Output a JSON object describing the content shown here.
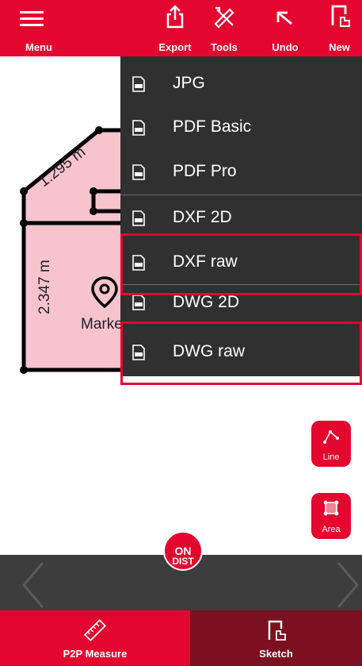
{
  "toolbar": {
    "menu_label": "Menu",
    "export_label": "Export",
    "tools_label": "Tools",
    "undo_label": "Undo",
    "new_label": "New"
  },
  "export_menu": {
    "items": [
      {
        "label": "JPG",
        "icon": "file-jpg-icon",
        "file_tag": "JPG"
      },
      {
        "label": "PDF Basic",
        "icon": "file-pdf-icon",
        "file_tag": "PDF"
      },
      {
        "label": "PDF Pro",
        "icon": "file-pdf-icon",
        "file_tag": "PDF"
      },
      {
        "label": "DXF 2D",
        "icon": "file-dxf-icon",
        "file_tag": "DXF"
      },
      {
        "label": "DXF raw",
        "icon": "file-dxf-icon",
        "file_tag": "DXF",
        "highlighted": true
      },
      {
        "label": "DWG 2D",
        "icon": "file-dwg-icon",
        "file_tag": "DWG"
      },
      {
        "label": "DWG raw",
        "icon": "file-dwg-icon",
        "file_tag": "DWG",
        "highlighted": true
      }
    ]
  },
  "sketch": {
    "dim_diagonal": "1.295 m",
    "dim_vertical": "2.347 m",
    "marker_label": "Marke",
    "room_fill": "#f7c3cd"
  },
  "side_tools": {
    "line_label": "Line",
    "area_label": "Area"
  },
  "ondist": {
    "on": "ON",
    "dist": "DIST"
  },
  "tabs": {
    "p2p_label": "P2P Measure",
    "sketch_label": "Sketch"
  },
  "colors": {
    "accent": "#e4062f",
    "menu_bg": "#303030",
    "nav_bg": "#3d3d3d",
    "tab_inactive": "#7a1020"
  }
}
